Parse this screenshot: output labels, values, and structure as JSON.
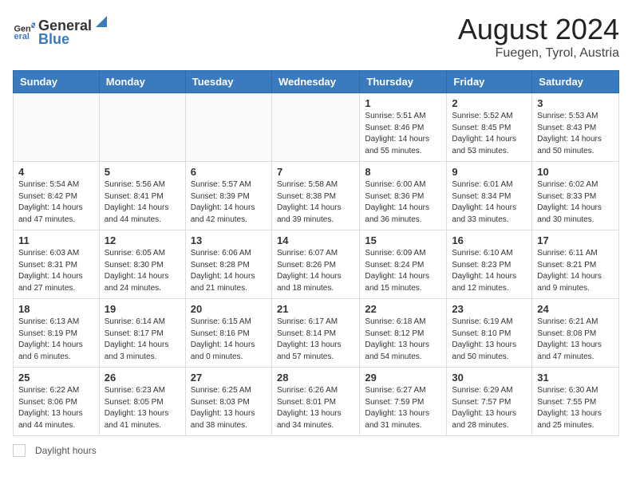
{
  "header": {
    "logo_general": "General",
    "logo_blue": "Blue",
    "title": "August 2024",
    "subtitle": "Fuegen, Tyrol, Austria"
  },
  "days_of_week": [
    "Sunday",
    "Monday",
    "Tuesday",
    "Wednesday",
    "Thursday",
    "Friday",
    "Saturday"
  ],
  "weeks": [
    [
      {
        "day": "",
        "info": ""
      },
      {
        "day": "",
        "info": ""
      },
      {
        "day": "",
        "info": ""
      },
      {
        "day": "",
        "info": ""
      },
      {
        "day": "1",
        "info": "Sunrise: 5:51 AM\nSunset: 8:46 PM\nDaylight: 14 hours\nand 55 minutes."
      },
      {
        "day": "2",
        "info": "Sunrise: 5:52 AM\nSunset: 8:45 PM\nDaylight: 14 hours\nand 53 minutes."
      },
      {
        "day": "3",
        "info": "Sunrise: 5:53 AM\nSunset: 8:43 PM\nDaylight: 14 hours\nand 50 minutes."
      }
    ],
    [
      {
        "day": "4",
        "info": "Sunrise: 5:54 AM\nSunset: 8:42 PM\nDaylight: 14 hours\nand 47 minutes."
      },
      {
        "day": "5",
        "info": "Sunrise: 5:56 AM\nSunset: 8:41 PM\nDaylight: 14 hours\nand 44 minutes."
      },
      {
        "day": "6",
        "info": "Sunrise: 5:57 AM\nSunset: 8:39 PM\nDaylight: 14 hours\nand 42 minutes."
      },
      {
        "day": "7",
        "info": "Sunrise: 5:58 AM\nSunset: 8:38 PM\nDaylight: 14 hours\nand 39 minutes."
      },
      {
        "day": "8",
        "info": "Sunrise: 6:00 AM\nSunset: 8:36 PM\nDaylight: 14 hours\nand 36 minutes."
      },
      {
        "day": "9",
        "info": "Sunrise: 6:01 AM\nSunset: 8:34 PM\nDaylight: 14 hours\nand 33 minutes."
      },
      {
        "day": "10",
        "info": "Sunrise: 6:02 AM\nSunset: 8:33 PM\nDaylight: 14 hours\nand 30 minutes."
      }
    ],
    [
      {
        "day": "11",
        "info": "Sunrise: 6:03 AM\nSunset: 8:31 PM\nDaylight: 14 hours\nand 27 minutes."
      },
      {
        "day": "12",
        "info": "Sunrise: 6:05 AM\nSunset: 8:30 PM\nDaylight: 14 hours\nand 24 minutes."
      },
      {
        "day": "13",
        "info": "Sunrise: 6:06 AM\nSunset: 8:28 PM\nDaylight: 14 hours\nand 21 minutes."
      },
      {
        "day": "14",
        "info": "Sunrise: 6:07 AM\nSunset: 8:26 PM\nDaylight: 14 hours\nand 18 minutes."
      },
      {
        "day": "15",
        "info": "Sunrise: 6:09 AM\nSunset: 8:24 PM\nDaylight: 14 hours\nand 15 minutes."
      },
      {
        "day": "16",
        "info": "Sunrise: 6:10 AM\nSunset: 8:23 PM\nDaylight: 14 hours\nand 12 minutes."
      },
      {
        "day": "17",
        "info": "Sunrise: 6:11 AM\nSunset: 8:21 PM\nDaylight: 14 hours\nand 9 minutes."
      }
    ],
    [
      {
        "day": "18",
        "info": "Sunrise: 6:13 AM\nSunset: 8:19 PM\nDaylight: 14 hours\nand 6 minutes."
      },
      {
        "day": "19",
        "info": "Sunrise: 6:14 AM\nSunset: 8:17 PM\nDaylight: 14 hours\nand 3 minutes."
      },
      {
        "day": "20",
        "info": "Sunrise: 6:15 AM\nSunset: 8:16 PM\nDaylight: 14 hours\nand 0 minutes."
      },
      {
        "day": "21",
        "info": "Sunrise: 6:17 AM\nSunset: 8:14 PM\nDaylight: 13 hours\nand 57 minutes."
      },
      {
        "day": "22",
        "info": "Sunrise: 6:18 AM\nSunset: 8:12 PM\nDaylight: 13 hours\nand 54 minutes."
      },
      {
        "day": "23",
        "info": "Sunrise: 6:19 AM\nSunset: 8:10 PM\nDaylight: 13 hours\nand 50 minutes."
      },
      {
        "day": "24",
        "info": "Sunrise: 6:21 AM\nSunset: 8:08 PM\nDaylight: 13 hours\nand 47 minutes."
      }
    ],
    [
      {
        "day": "25",
        "info": "Sunrise: 6:22 AM\nSunset: 8:06 PM\nDaylight: 13 hours\nand 44 minutes."
      },
      {
        "day": "26",
        "info": "Sunrise: 6:23 AM\nSunset: 8:05 PM\nDaylight: 13 hours\nand 41 minutes."
      },
      {
        "day": "27",
        "info": "Sunrise: 6:25 AM\nSunset: 8:03 PM\nDaylight: 13 hours\nand 38 minutes."
      },
      {
        "day": "28",
        "info": "Sunrise: 6:26 AM\nSunset: 8:01 PM\nDaylight: 13 hours\nand 34 minutes."
      },
      {
        "day": "29",
        "info": "Sunrise: 6:27 AM\nSunset: 7:59 PM\nDaylight: 13 hours\nand 31 minutes."
      },
      {
        "day": "30",
        "info": "Sunrise: 6:29 AM\nSunset: 7:57 PM\nDaylight: 13 hours\nand 28 minutes."
      },
      {
        "day": "31",
        "info": "Sunrise: 6:30 AM\nSunset: 7:55 PM\nDaylight: 13 hours\nand 25 minutes."
      }
    ]
  ],
  "footer": {
    "legend_label": "Daylight hours"
  }
}
